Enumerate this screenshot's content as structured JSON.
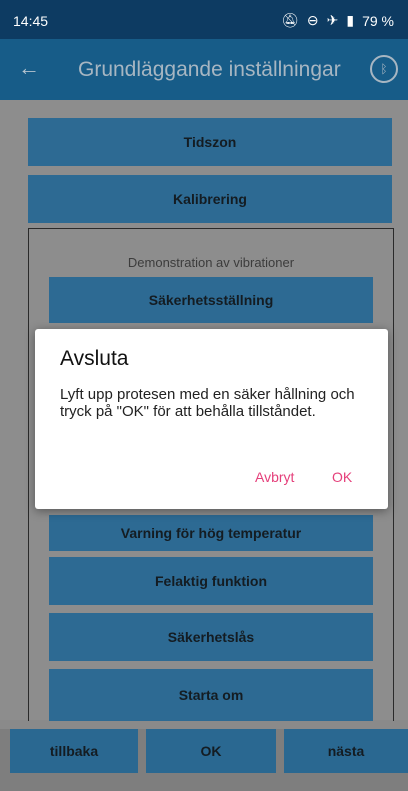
{
  "statusbar": {
    "time": "14:45",
    "battery": "79 %"
  },
  "appbar": {
    "title": "Grundläggande inställningar"
  },
  "main": {
    "buttons": [
      "Tidszon",
      "Kalibrering"
    ],
    "panel_title": "Demonstration av vibrationer",
    "panel_buttons": [
      "Säkerhetsställning",
      "Varning för hög temperatur",
      "Felaktig funktion",
      "Säkerhetslås",
      "Starta om"
    ]
  },
  "bottom": {
    "back": "tillbaka",
    "ok": "OK",
    "next": "nästa"
  },
  "dialog": {
    "title": "Avsluta",
    "body": "Lyft upp protesen med en säker hållning och tryck på \"OK\" för att behålla tillståndet.",
    "cancel": "Avbryt",
    "ok": "OK"
  },
  "colors": {
    "accent": "#e5407b",
    "primary": "#175c88",
    "button": "#2d6a93"
  }
}
